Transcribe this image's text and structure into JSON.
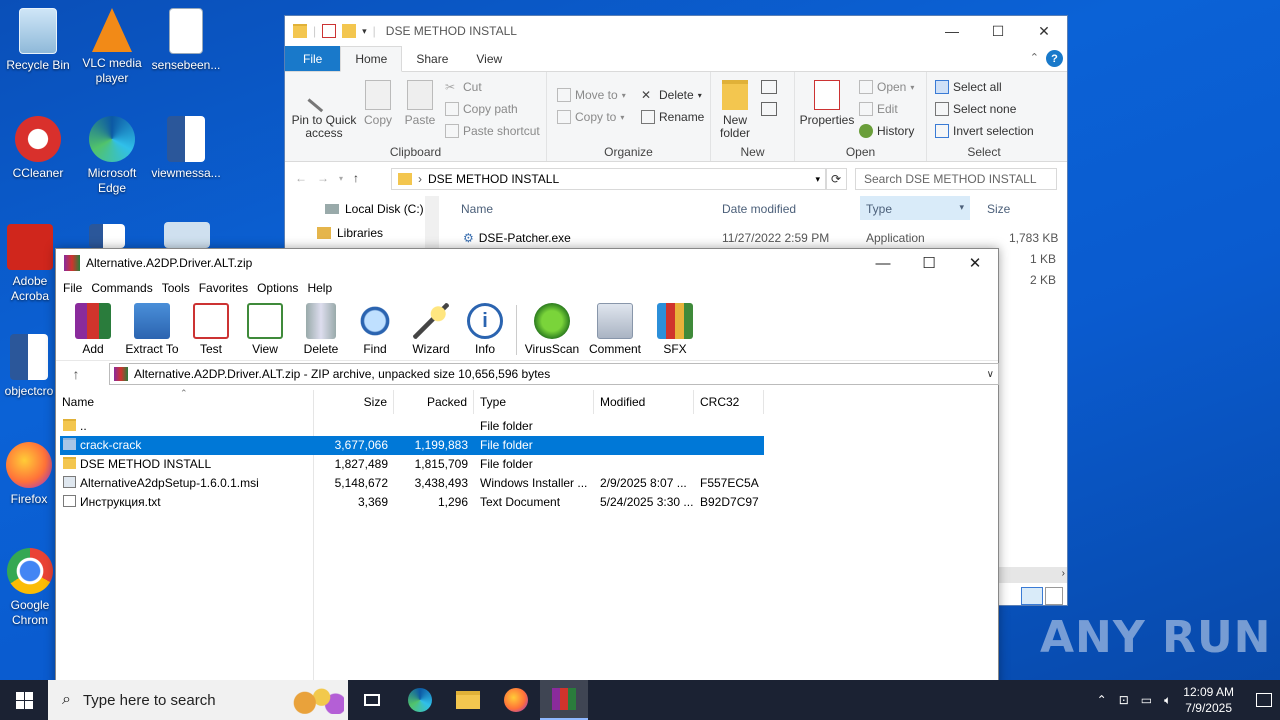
{
  "desktop": {
    "icons": [
      {
        "label": "Recycle Bin"
      },
      {
        "label": "VLC media player"
      },
      {
        "label": "sensebeen..."
      },
      {
        "label": "CCleaner"
      },
      {
        "label": "Microsoft Edge"
      },
      {
        "label": "viewmessa..."
      },
      {
        "label": "Adobe Acroba"
      },
      {
        "label": "objectcro"
      },
      {
        "label": "Firefox"
      },
      {
        "label": "Google Chrom"
      }
    ],
    "watermark": "ANY RUN"
  },
  "explorer": {
    "title": "DSE METHOD INSTALL",
    "tabs": [
      "File",
      "Home",
      "Share",
      "View"
    ],
    "ribbon": {
      "clipboard": {
        "pin": "Pin to Quick access",
        "copy": "Copy",
        "paste": "Paste",
        "cut": "Cut",
        "copy_path": "Copy path",
        "paste_shortcut": "Paste shortcut",
        "group": "Clipboard"
      },
      "organize": {
        "move_to": "Move to",
        "copy_to": "Copy to",
        "delete": "Delete",
        "rename": "Rename",
        "group": "Organize"
      },
      "new": {
        "new_folder": "New folder",
        "group": "New"
      },
      "open": {
        "properties": "Properties",
        "open": "Open",
        "edit": "Edit",
        "history": "History",
        "group": "Open"
      },
      "select": {
        "select_all": "Select all",
        "select_none": "Select none",
        "invert": "Invert selection",
        "group": "Select"
      }
    },
    "address": "DSE METHOD INSTALL",
    "search_placeholder": "Search DSE METHOD INSTALL",
    "nav": [
      "Local Disk (C:)",
      "Libraries"
    ],
    "columns": [
      "Name",
      "Date modified",
      "Type",
      "Size"
    ],
    "files": [
      {
        "name": "DSE-Patcher.exe",
        "date": "11/27/2022 2:59 PM",
        "type": "Application",
        "size": "1,783 KB"
      },
      {
        "size": "1 KB"
      },
      {
        "size": "2 KB"
      }
    ]
  },
  "winrar": {
    "title": "Alternative.A2DP.Driver.ALT.zip",
    "menu": [
      "File",
      "Commands",
      "Tools",
      "Favorites",
      "Options",
      "Help"
    ],
    "toolbar": [
      "Add",
      "Extract To",
      "Test",
      "View",
      "Delete",
      "Find",
      "Wizard",
      "Info",
      "VirusScan",
      "Comment",
      "SFX"
    ],
    "path": "Alternative.A2DP.Driver.ALT.zip - ZIP archive, unpacked size 10,656,596 bytes",
    "columns": [
      "Name",
      "Size",
      "Packed",
      "Type",
      "Modified",
      "CRC32"
    ],
    "rows": [
      {
        "name": "..",
        "size": "",
        "packed": "",
        "type": "File folder",
        "modified": "",
        "crc": ""
      },
      {
        "name": "crack-crack",
        "size": "3,677,066",
        "packed": "1,199,883",
        "type": "File folder",
        "modified": "",
        "crc": ""
      },
      {
        "name": "DSE METHOD INSTALL",
        "size": "1,827,489",
        "packed": "1,815,709",
        "type": "File folder",
        "modified": "",
        "crc": ""
      },
      {
        "name": "AlternativeA2dpSetup-1.6.0.1.msi",
        "size": "5,148,672",
        "packed": "3,438,493",
        "type": "Windows Installer ...",
        "modified": "2/9/2025 8:07 ...",
        "crc": "F557EC5A"
      },
      {
        "name": "Инструкция.txt",
        "size": "3,369",
        "packed": "1,296",
        "type": "Text Document",
        "modified": "5/24/2025 3:30 ...",
        "crc": "B92D7C97"
      }
    ]
  },
  "taskbar": {
    "search_placeholder": "Type here to search",
    "time": "12:09 AM",
    "date": "7/9/2025"
  }
}
